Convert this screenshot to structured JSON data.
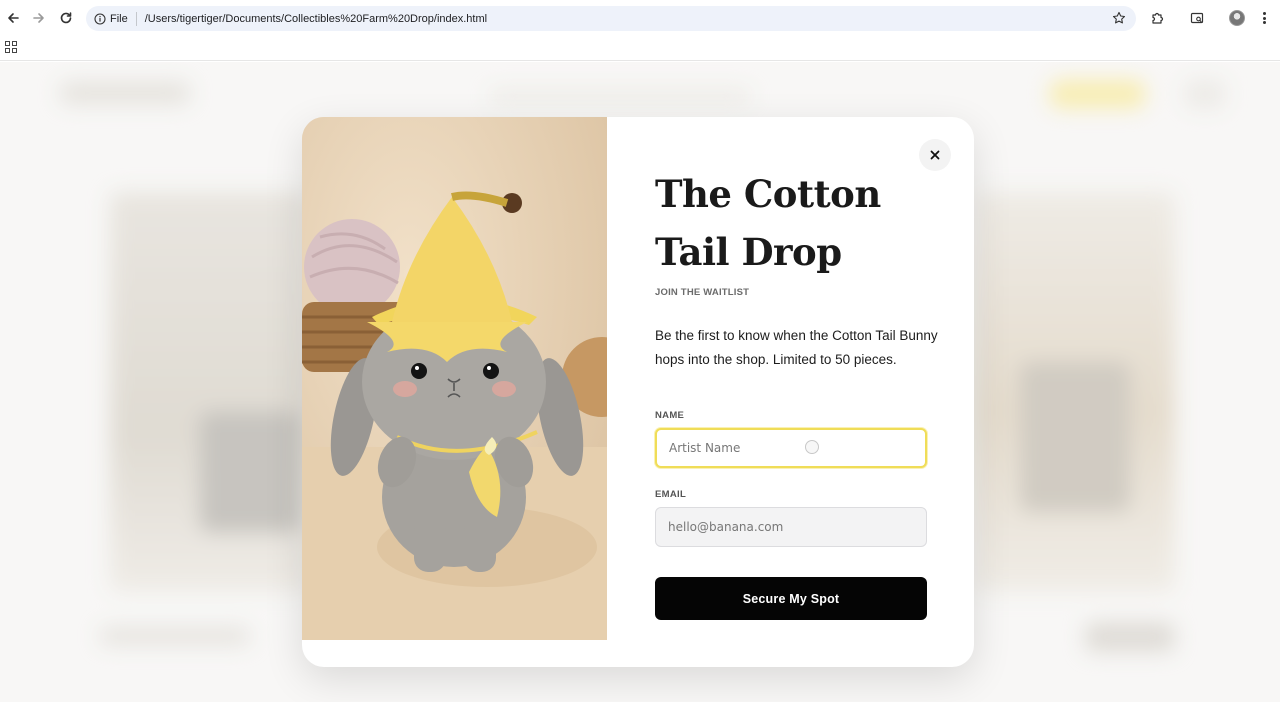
{
  "browser": {
    "security_label": "File",
    "url": "/Users/tigertiger/Documents/Collectibles%20Farm%20Drop/index.html",
    "icons": [
      "back-icon",
      "forward-icon",
      "reload-icon",
      "info-icon",
      "star-icon",
      "extensions-icon",
      "tab-search-icon",
      "profile-avatar",
      "more-menu-icon",
      "apps-icon"
    ]
  },
  "modal": {
    "title": "The Cotton Tail Drop",
    "subtitle": "JOIN THE WAITLIST",
    "description": "Be the first to know when the Cotton Tail Bunny hops into the shop. Limited to 50 pieces.",
    "name_label": "NAME",
    "name_placeholder": "Artist Name",
    "email_label": "EMAIL",
    "email_placeholder": "hello@banana.com",
    "submit_label": "Secure My Spot",
    "close_icon": "close-icon",
    "accent_color": "#f0dd58",
    "button_color": "#050505"
  }
}
